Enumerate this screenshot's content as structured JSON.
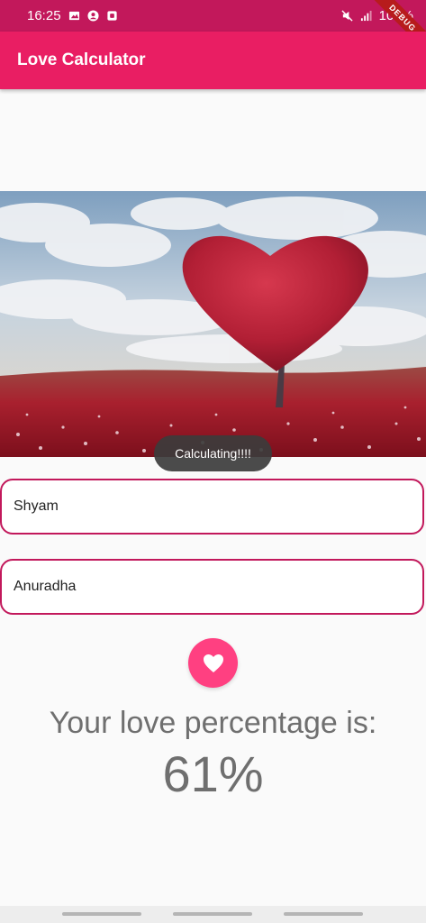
{
  "status_bar": {
    "time": "16:25",
    "battery": "100%",
    "icons": [
      "image-icon",
      "account-icon",
      "app-icon",
      "mute-icon",
      "signal-icon"
    ]
  },
  "debug_banner": "DEBUG",
  "app_bar": {
    "title": "Love Calculator"
  },
  "toast": {
    "text": "Calculating!!!!"
  },
  "form": {
    "name1": "Shyam",
    "name2": "Anuradha"
  },
  "calculate_button": {
    "icon": "heart-icon"
  },
  "result": {
    "label": "Your love percentage is:",
    "value": "61%"
  },
  "colors": {
    "status_bar": "#c2185b",
    "app_bar": "#e91e63",
    "accent": "#ff4081",
    "field_border": "#c2185b"
  }
}
